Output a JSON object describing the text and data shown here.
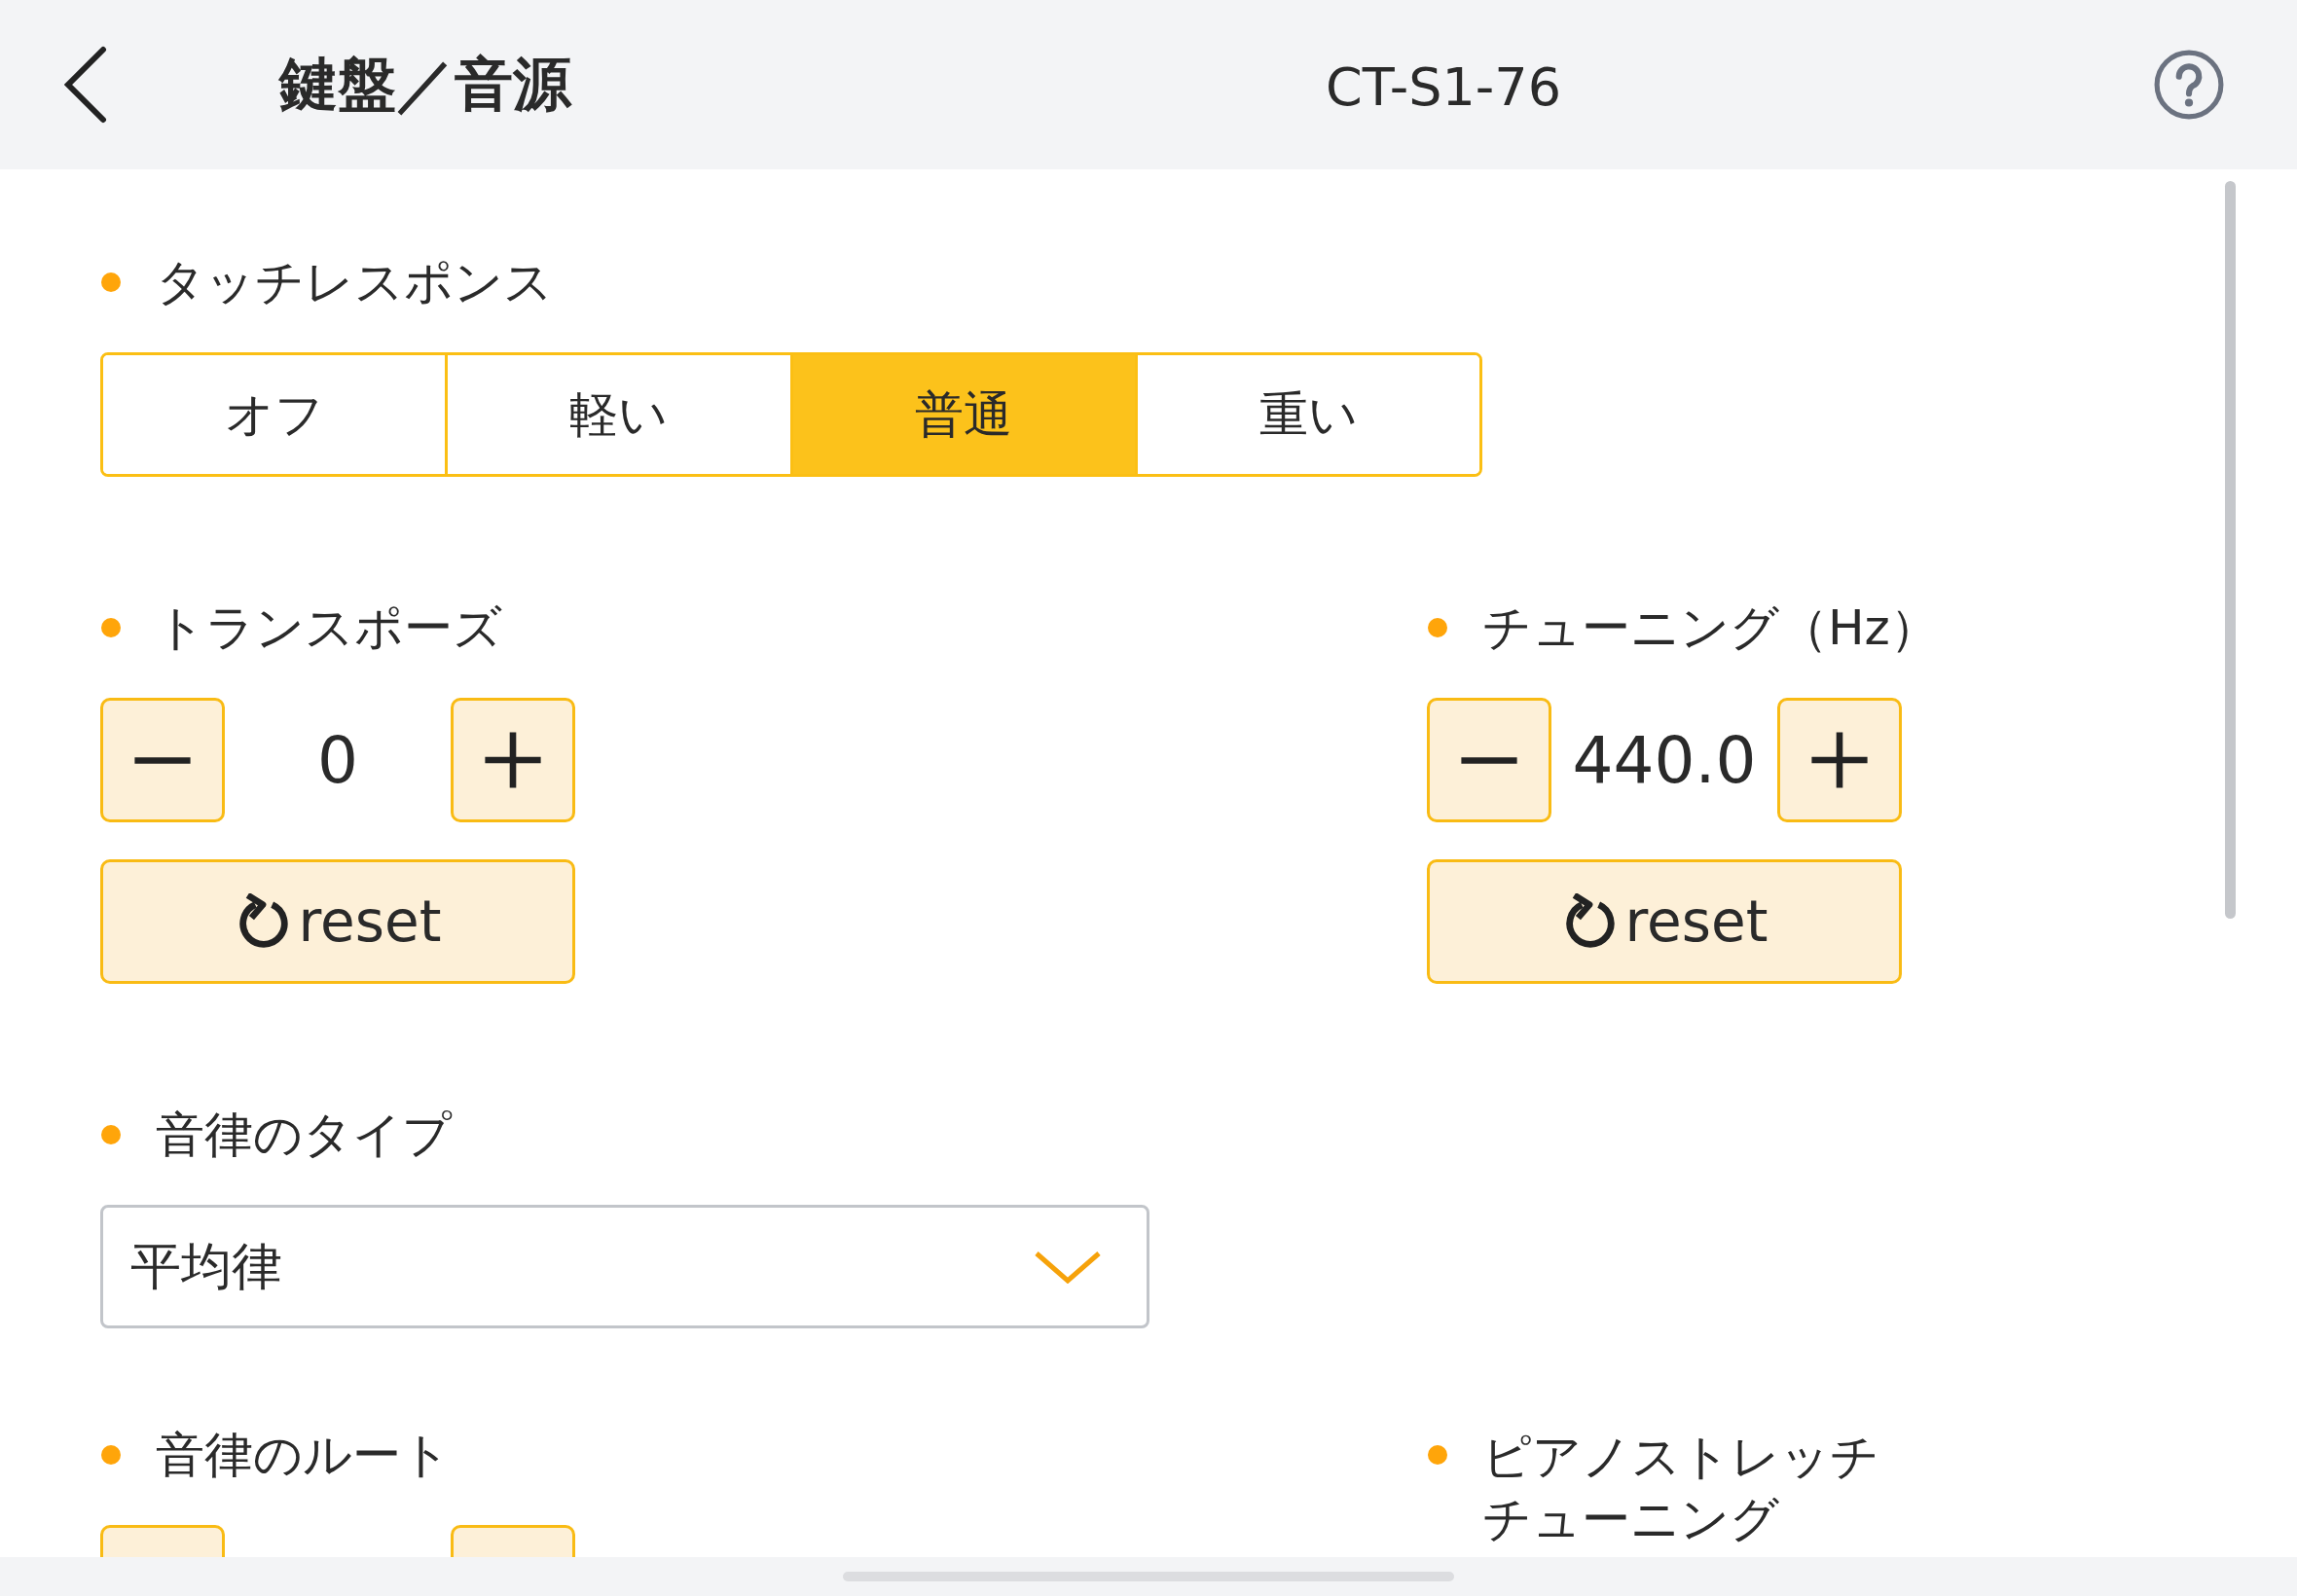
{
  "header": {
    "title": "鍵盤／音源",
    "model": "CT-S1-76"
  },
  "rows": [
    [
      {
        "title": "タッチレスポンス",
        "kind": "segmented",
        "options": [
          {
            "label": "オフ",
            "selected": false
          },
          {
            "label": "軽い",
            "selected": false
          },
          {
            "label": "普通",
            "selected": true
          },
          {
            "label": "重い",
            "selected": false
          }
        ]
      }
    ],
    [
      {
        "title": "トランスポーズ",
        "kind": "stepper",
        "value": "0",
        "reset": "reset"
      },
      {
        "title": "チューニング（Hz）",
        "kind": "stepper",
        "value": "440.0",
        "reset": "reset"
      }
    ],
    [
      {
        "title": "音律のタイプ",
        "kind": "select",
        "value": "平均律"
      }
    ],
    [
      {
        "title": "音律のルート",
        "kind": "stepper_cut"
      },
      {
        "title": "ピアノストレッチチューニング",
        "kind": "heading_only"
      }
    ]
  ]
}
